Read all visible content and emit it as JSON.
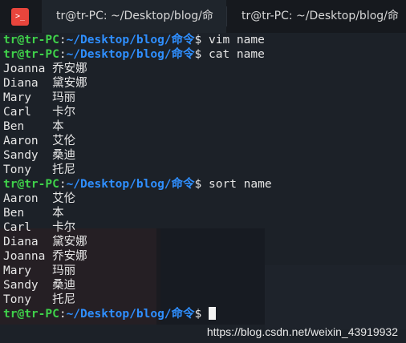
{
  "tabs": [
    {
      "label": "tr@tr-PC: ~/Desktop/blog/命",
      "active": true
    },
    {
      "label": "tr@tr-PC: ~/Desktop/blog/命",
      "active": false
    }
  ],
  "app_icon": ">_",
  "prompt": {
    "user": "tr@tr-PC",
    "colon": ":",
    "path": "~/Desktop/blog/命令",
    "symbol": "$"
  },
  "commands": [
    "vim name",
    "cat name",
    "sort name"
  ],
  "cat_output": [
    "Joanna 乔安娜",
    "Diana  黛安娜",
    "Mary   玛丽",
    "Carl   卡尔",
    "Ben    本",
    "Aaron  艾伦",
    "Sandy  桑迪",
    "Tony   托尼"
  ],
  "sort_output": [
    "Aaron  艾伦",
    "Ben    本",
    "Carl   卡尔",
    "Diana  黛安娜",
    "Joanna 乔安娜",
    "Mary   玛丽",
    "Sandy  桑迪",
    "Tony   托尼"
  ],
  "watermark": "https://blog.csdn.net/weixin_43919932",
  "colors": {
    "user": "#3fd14a",
    "path": "#2f8fff",
    "text": "#e6e6e6",
    "background": "#1c2128",
    "icon": "#e8453c"
  }
}
